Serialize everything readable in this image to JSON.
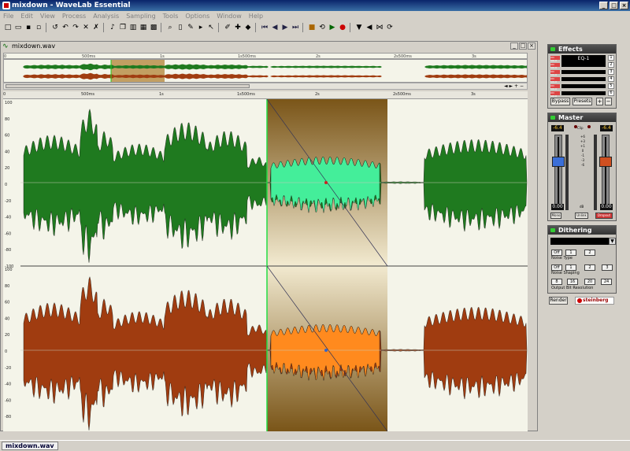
{
  "window": {
    "title": "mixdown - WaveLab Essential",
    "buttons": [
      "_",
      "□",
      "×"
    ]
  },
  "menu": [
    "File",
    "Edit",
    "View",
    "Process",
    "Analysis",
    "Sampling",
    "Tools",
    "Options",
    "Window",
    "Help"
  ],
  "toolbar_icons": [
    "new-icon",
    "open-icon",
    "save-icon",
    "save-as-icon",
    "revert-icon",
    "undo-icon",
    "redo-icon",
    "cut-icon",
    "delete-icon",
    "speaker-icon",
    "copy-icon",
    "split-view-icon",
    "tile-icon",
    "grid-icon",
    "zoom-icon",
    "select-icon",
    "pencil-icon",
    "play-tool-icon",
    "cursor-icon",
    "edit-tool-icon",
    "marker-icon",
    "locate-icon",
    "prev-icon",
    "rewind-icon",
    "forward-icon",
    "next-icon",
    "stop-icon",
    "loop-icon",
    "play-icon",
    "record-icon",
    "meter-icon",
    "filter-icon",
    "compare-icon",
    "refresh-icon"
  ],
  "document": {
    "tab": "mixdown.wav",
    "overview_ruler": [
      "0",
      "500ms",
      "1s",
      "1s500ms",
      "2s",
      "2s500ms",
      "3s"
    ],
    "ruler": [
      "0",
      "500ms",
      "1s",
      "1s500ms",
      "2s",
      "2s500ms",
      "3s"
    ],
    "y_labels": [
      "100",
      "80",
      "60",
      "40",
      "20",
      "0",
      "-20",
      "-40",
      "-60",
      "-80",
      "-100"
    ],
    "colors": {
      "top": "#1f7a1f",
      "top_sel": "#44ee9a",
      "bottom": "#a03c10",
      "bottom_sel": "#ff8a1e",
      "selection": "#8a6420"
    }
  },
  "status_tab": "mixdown.wav",
  "effects": {
    "title": "Effects",
    "slot_on": "ON",
    "slot_solo": "SOLO",
    "slots": [
      "1",
      "2",
      "3",
      "4",
      "5",
      "6"
    ],
    "slot1_name": "EQ-1",
    "bypass": "Bypass",
    "presets": "Presets",
    "plus": "+",
    "minus": "−"
  },
  "master": {
    "title": "Master",
    "left_peak": "-6.4",
    "right_peak": "-6.4",
    "clip": "Clip",
    "scale": [
      "+6",
      "+3",
      "+1",
      "0",
      "-1",
      "-3",
      "-6"
    ],
    "left_val": "0.00",
    "right_val": "0.00",
    "db": "dB",
    "mono": "Mono",
    "unlink": "Unlink",
    "dropout": "Dropout"
  },
  "dithering": {
    "title": "Dithering",
    "off1": "Off",
    "n1": "1",
    "n2": "2",
    "noise_type": "Noise  Type",
    "off2": "Off",
    "s1": "1",
    "s2": "2",
    "s3": "3",
    "noise_shaping": "Noise  Shaping",
    "b8": "8",
    "b16": "16",
    "b20": "20",
    "b24": "24",
    "output_bit": "Output Bit Resolution"
  },
  "render": "Render",
  "brand": "steinberg"
}
